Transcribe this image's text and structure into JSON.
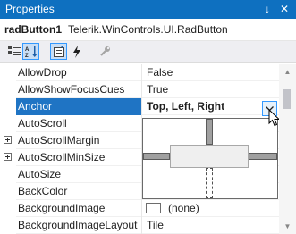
{
  "window": {
    "title": "Properties",
    "pin_glyph": "↓",
    "close_glyph": "✕",
    "pin_icon": "pin-icon",
    "close_icon": "close-icon"
  },
  "object": {
    "name": "radButton1",
    "type": "Telerik.WinControls.UI.RadButton"
  },
  "toolbar": {
    "buttons": [
      {
        "icon": "categorized-icon",
        "active": false
      },
      {
        "icon": "alphabetical-icon",
        "active": true
      },
      {
        "icon": "properties-icon",
        "active": true
      },
      {
        "icon": "events-icon",
        "active": false
      },
      {
        "icon": "property-pages-icon",
        "active": false
      }
    ]
  },
  "properties": [
    {
      "name": "AllowDrop",
      "value": "False"
    },
    {
      "name": "AllowShowFocusCues",
      "value": "True"
    },
    {
      "name": "Anchor",
      "value": "Top, Left, Right",
      "selected": true
    },
    {
      "name": "AutoScroll",
      "value": ""
    },
    {
      "name": "AutoScrollMargin",
      "value": "",
      "expandable": true
    },
    {
      "name": "AutoScrollMinSize",
      "value": "",
      "expandable": true
    },
    {
      "name": "AutoSize",
      "value": ""
    },
    {
      "name": "BackColor",
      "value": ""
    },
    {
      "name": "BackgroundImage",
      "value": "(none)",
      "swatch": true
    },
    {
      "name": "BackgroundImageLayout",
      "value": "Tile"
    }
  ],
  "anchor_editor": {
    "top": true,
    "left": true,
    "right": true,
    "bottom": false
  },
  "colors": {
    "title_bar": "#0e70c0",
    "selection": "#1f74c4",
    "focus_border": "#3399ff"
  }
}
